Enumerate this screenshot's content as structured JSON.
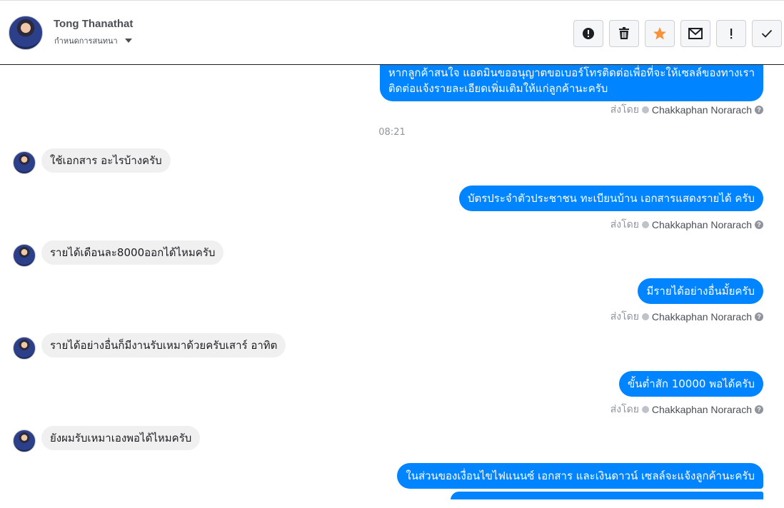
{
  "header": {
    "contact_name": "Tong Thanathat",
    "assign_label": "กำหนดการสนทนา"
  },
  "toolbar": [
    {
      "name": "spam-button",
      "icon": "alert-circle-icon"
    },
    {
      "name": "delete-button",
      "icon": "trash-icon"
    },
    {
      "name": "star-button",
      "icon": "star-icon",
      "color": "#f7923b"
    },
    {
      "name": "mark-unread-button",
      "icon": "envelope-icon"
    },
    {
      "name": "follow-up-button",
      "icon": "exclamation-icon"
    },
    {
      "name": "done-button",
      "icon": "checkmark-icon"
    }
  ],
  "thread": {
    "first_out_line1": "หากลูกค้าสนใจ แอดมินขออนุญาตขอเบอร์โทรติดต่อเพื่อที่จะให้เซลล์ของทางเรา",
    "first_out_line2": "ติดต่อแจ้งรายละเอียดเพิ่มเติมให้แก่ลูกค้านะครับ",
    "timestamp": "08:21",
    "sent_by_label": "ส่งโดย",
    "agent_name": "Chakkaphan Norarach",
    "messages": [
      {
        "direction": "in",
        "text": "ใช้เอกสาร อะไรบ้างครับ"
      },
      {
        "direction": "out",
        "text": "บัตรประจำตัวประชาชน ทะเบียนบ้าน เอกสารแสดงรายได้ ครับ"
      },
      {
        "direction": "in",
        "text": "รายได้เดือนละ8000ออกได้ไหมครับ"
      },
      {
        "direction": "out",
        "text": "มีรายได้อย่างอื่นมั้ยครับ"
      },
      {
        "direction": "in",
        "text": "รายได้อย่างอื่นก็มีงานรับเหมาด้วยครับเสาร์ อาทิต"
      },
      {
        "direction": "out",
        "text": "ขั้นต่ำสัก 10000 พอได้ครับ"
      },
      {
        "direction": "in",
        "text": "ยังผมรับเหมาเองพอได้ไหมครับ"
      },
      {
        "direction": "out",
        "text": "ในส่วนของเงื่อนไขไฟแนนซ์ เอกสาร และเงินดาวน์ เซลล์จะแจ้งลูกค้านะครับ"
      }
    ]
  },
  "colors": {
    "outgoing_bubble": "#0084ff",
    "incoming_bubble": "#f1f0f0",
    "star": "#f7923b"
  }
}
